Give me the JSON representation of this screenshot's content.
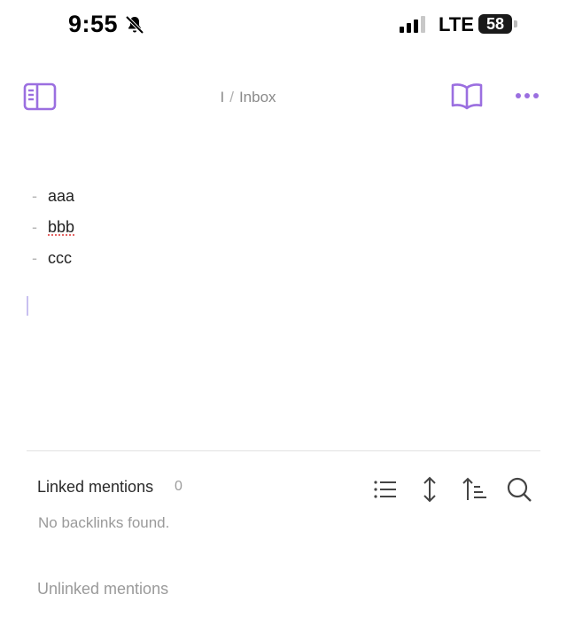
{
  "status_bar": {
    "time": "9:55",
    "network": "LTE",
    "battery": "58",
    "icons": [
      "bell-slash-icon",
      "signal-icon"
    ]
  },
  "header": {
    "breadcrumb_parent": "I",
    "breadcrumb_separator": "/",
    "breadcrumb_current": "Inbox",
    "icons": [
      "sidebar-toggle-icon",
      "book-open-icon",
      "more-horizontal-icon"
    ],
    "accent_color": "#9b6fe0"
  },
  "editor": {
    "items": [
      {
        "marker": "-",
        "text": "aaa"
      },
      {
        "marker": "-",
        "text": "bbb"
      },
      {
        "marker": "-",
        "text": "ccc"
      }
    ]
  },
  "backlinks": {
    "linked_title": "Linked mentions",
    "linked_count": "0",
    "empty_message": "No backlinks found.",
    "unlinked_title": "Unlinked mentions",
    "tool_icons": [
      "list-icon",
      "expand-vertical-icon",
      "sort-icon",
      "search-icon"
    ]
  }
}
